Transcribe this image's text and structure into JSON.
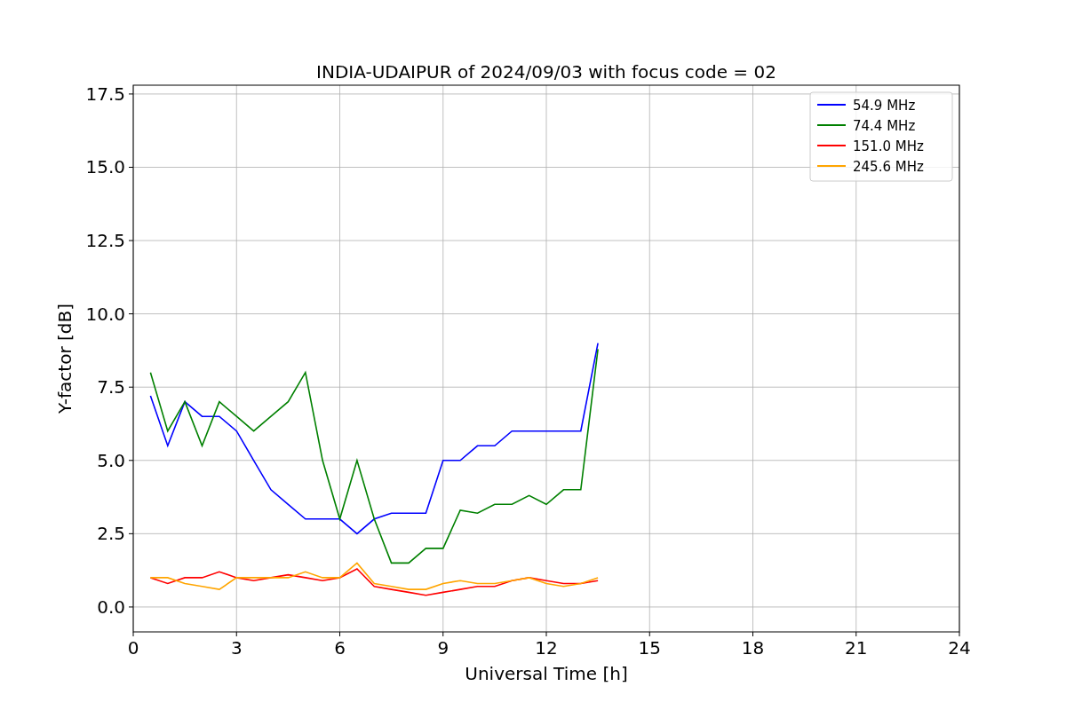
{
  "chart": {
    "chart_data": {
      "type": "line",
      "title": "INDIA-UDAIPUR of 2024/09/03 with focus code = 02",
      "xlabel": "Universal Time [h]",
      "ylabel": "Y-factor [dB]",
      "x": [
        0.5,
        1,
        1.5,
        2,
        2.5,
        3,
        3.5,
        4,
        4.5,
        5,
        5.5,
        6,
        6.5,
        7,
        7.5,
        8,
        8.5,
        9,
        9.5,
        10,
        10.5,
        11,
        11.5,
        12,
        12.5,
        13,
        13.5
      ],
      "series": [
        {
          "name": "54.9 MHz",
          "color": "#0000ff",
          "values": [
            7.2,
            5.5,
            7,
            6.5,
            6.5,
            6,
            5,
            4,
            3.5,
            3,
            3,
            3,
            2.5,
            3,
            3.2,
            3.2,
            3.2,
            5,
            5,
            5.5,
            5.5,
            6,
            6,
            6,
            6,
            6,
            9
          ]
        },
        {
          "name": "74.4 MHz",
          "color": "#008000",
          "values": [
            8,
            6,
            7,
            5.5,
            7,
            6.5,
            6,
            6.5,
            7,
            8,
            5,
            3,
            5,
            3,
            1.5,
            1.5,
            2,
            2,
            3.3,
            3.2,
            3.5,
            3.5,
            3.8,
            3.5,
            4,
            4,
            8.8
          ]
        },
        {
          "name": "151.0 MHz",
          "color": "#ff0000",
          "values": [
            1,
            0.8,
            1,
            1,
            1.2,
            1,
            0.9,
            1,
            1.1,
            1,
            0.9,
            1,
            1.3,
            0.7,
            0.6,
            0.5,
            0.4,
            0.5,
            0.6,
            0.7,
            0.7,
            0.9,
            1,
            0.9,
            0.8,
            0.8,
            0.9
          ]
        },
        {
          "name": "245.6 MHz",
          "color": "#ffa500",
          "values": [
            1,
            1,
            0.8,
            0.7,
            0.6,
            1,
            1,
            1,
            1,
            1.2,
            1,
            1,
            1.5,
            0.8,
            0.7,
            0.6,
            0.6,
            0.8,
            0.9,
            0.8,
            0.8,
            0.9,
            1,
            0.8,
            0.7,
            0.8,
            1
          ]
        }
      ],
      "grid": true,
      "legend": true,
      "xlim": [
        0,
        24
      ],
      "ylim": [
        -0.85,
        17.8
      ],
      "xticks": [
        0,
        3,
        6,
        9,
        12,
        15,
        18,
        21,
        24
      ],
      "yticks": [
        {
          "value": 0,
          "label": "0.0"
        },
        {
          "value": 2.5,
          "label": "2.5"
        },
        {
          "value": 5,
          "label": "5.0"
        },
        {
          "value": 7.5,
          "label": "7.5"
        },
        {
          "value": 10,
          "label": "10.0"
        },
        {
          "value": 12.5,
          "label": "12.5"
        },
        {
          "value": 15,
          "label": "15.0"
        },
        {
          "value": 17.5,
          "label": "17.5"
        }
      ]
    }
  }
}
